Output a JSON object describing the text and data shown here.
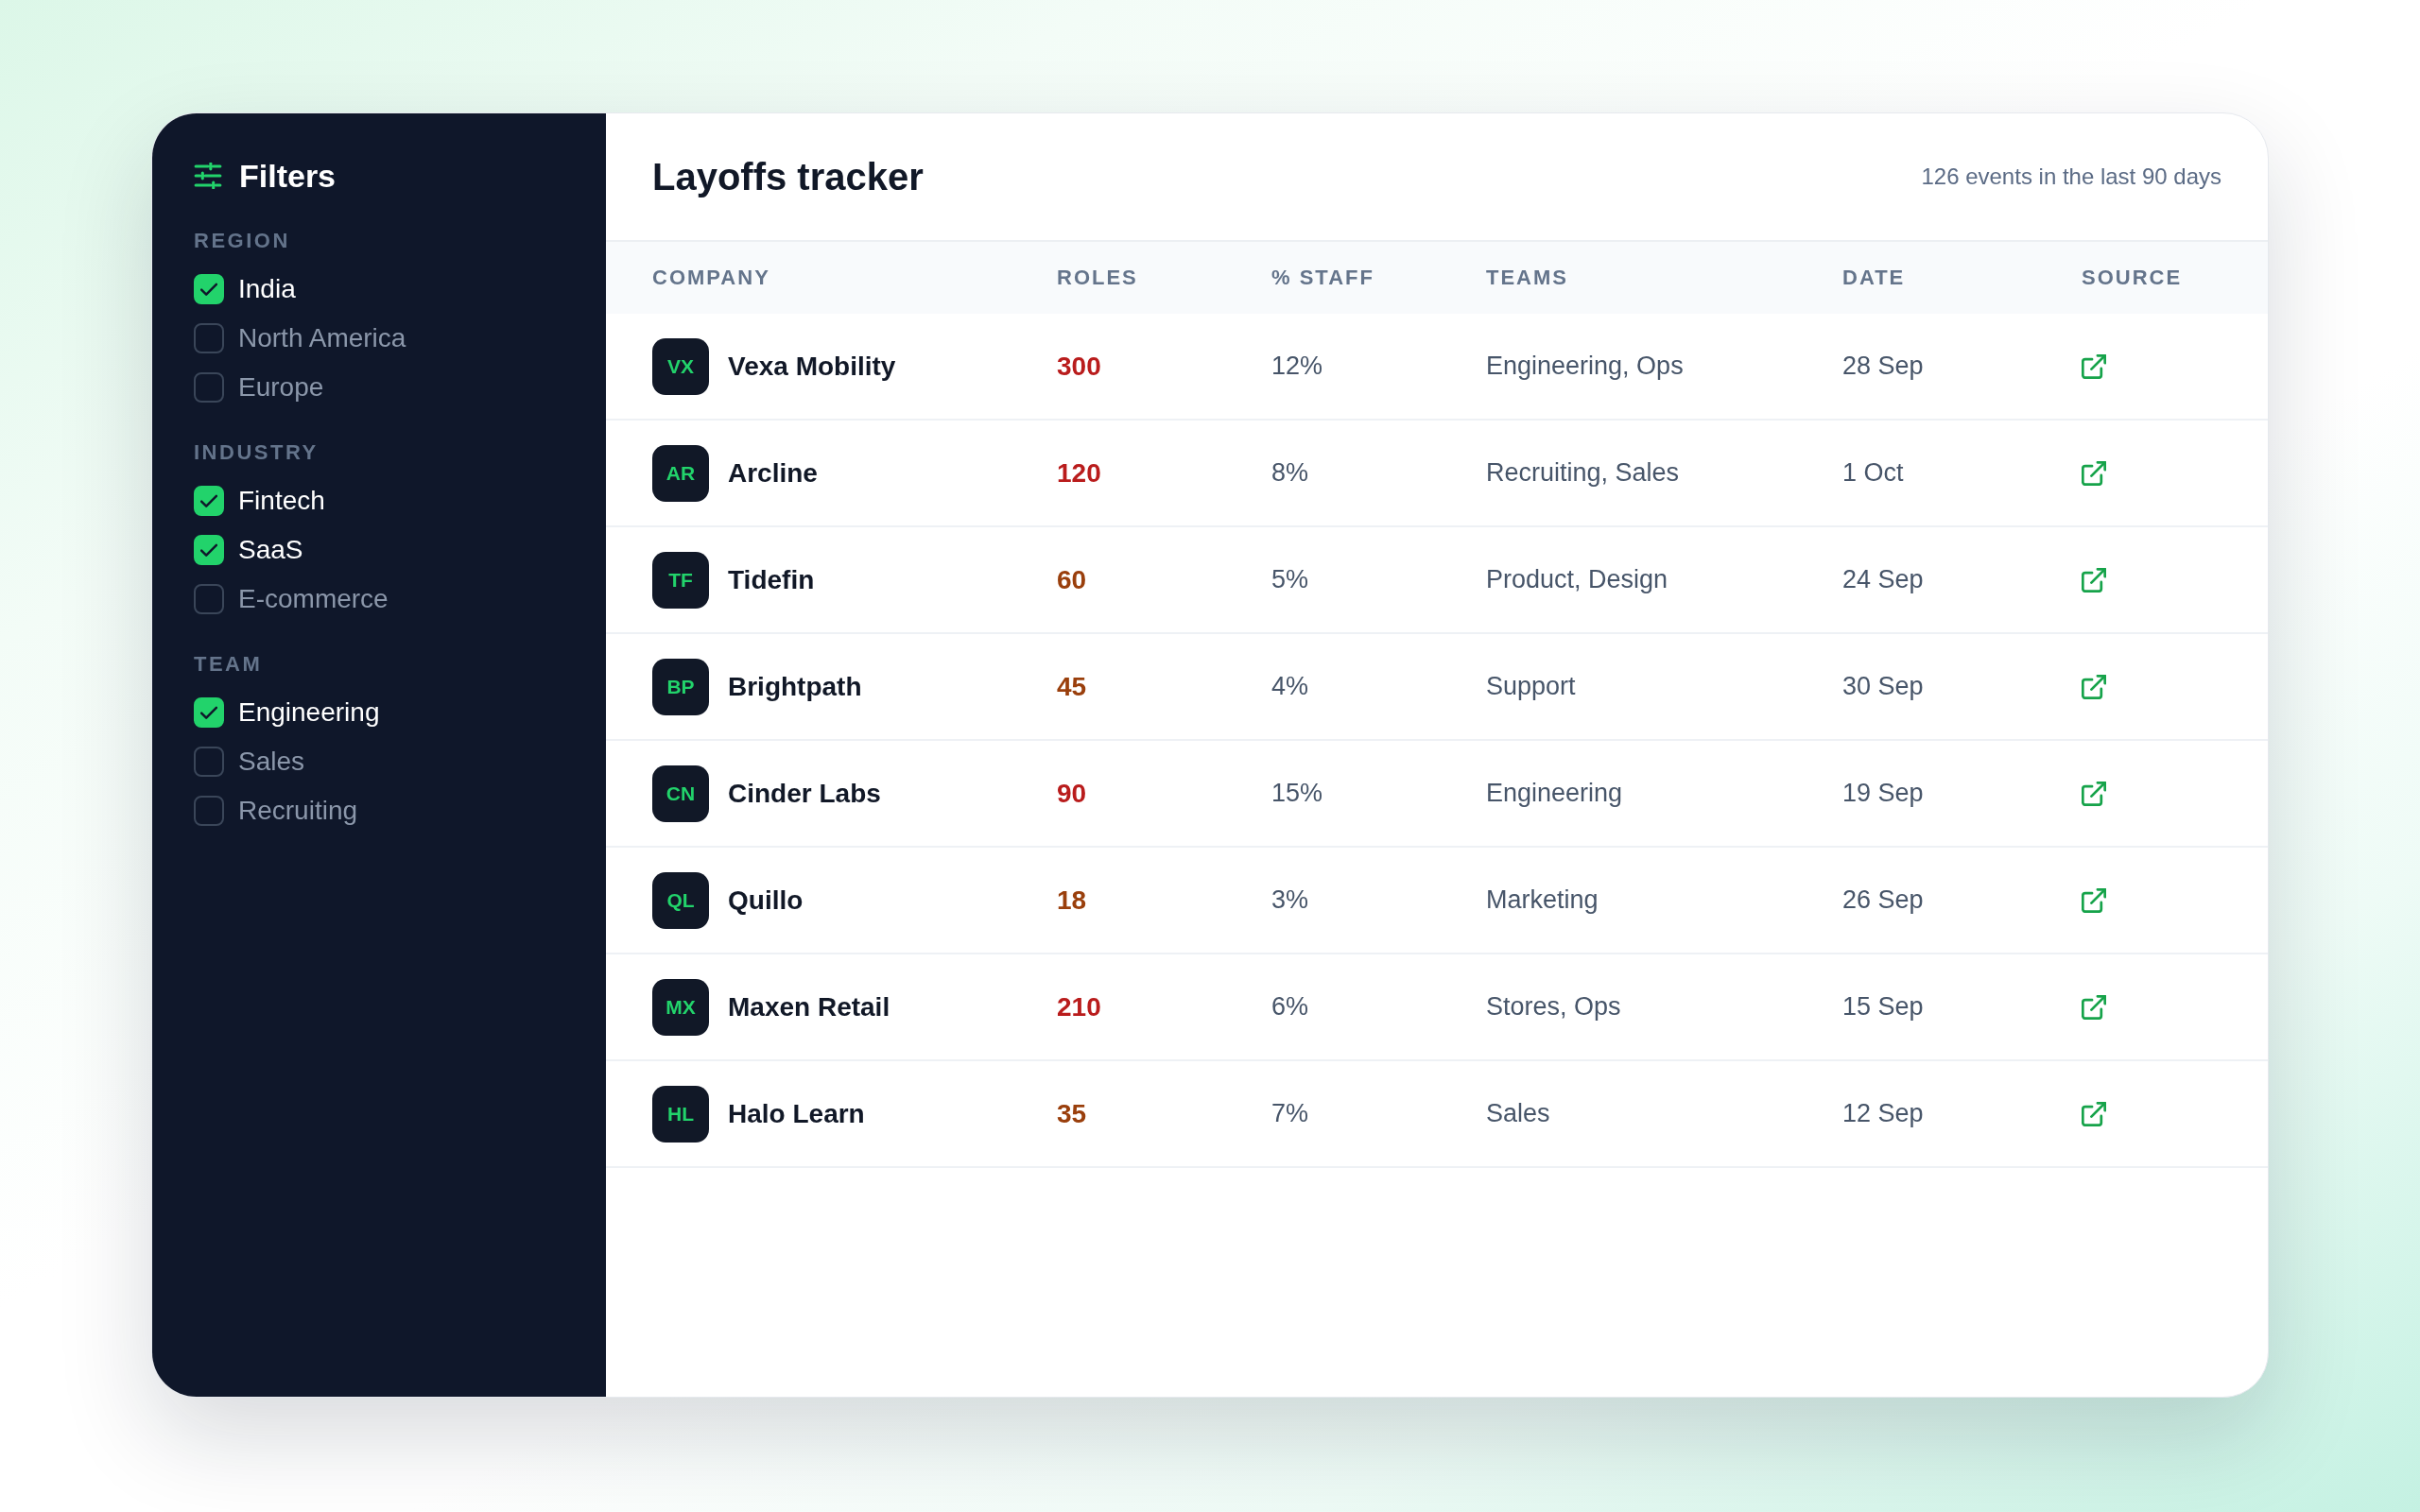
{
  "sidebar": {
    "title": "Filters",
    "groups": [
      {
        "label": "REGION",
        "options": [
          {
            "label": "India",
            "checked": true
          },
          {
            "label": "North America",
            "checked": false
          },
          {
            "label": "Europe",
            "checked": false
          }
        ]
      },
      {
        "label": "INDUSTRY",
        "options": [
          {
            "label": "Fintech",
            "checked": true
          },
          {
            "label": "SaaS",
            "checked": true
          },
          {
            "label": "E-commerce",
            "checked": false
          }
        ]
      },
      {
        "label": "TEAM",
        "options": [
          {
            "label": "Engineering",
            "checked": true
          },
          {
            "label": "Sales",
            "checked": false
          },
          {
            "label": "Recruiting",
            "checked": false
          }
        ]
      }
    ]
  },
  "header": {
    "title": "Layoffs tracker",
    "summary": "126 events in the last 90 days"
  },
  "table": {
    "columns": [
      "COMPANY",
      "ROLES",
      "% STAFF",
      "TEAMS",
      "DATE",
      "SOURCE"
    ],
    "rows": [
      {
        "initials": "VX",
        "company": "Vexa Mobility",
        "roles": "300",
        "color": "#b91c1c",
        "staff": "12%",
        "teams": "Engineering, Ops",
        "date": "28 Sep"
      },
      {
        "initials": "AR",
        "company": "Arcline",
        "roles": "120",
        "color": "#b91c1c",
        "staff": "8%",
        "teams": "Recruiting, Sales",
        "date": "1 Oct"
      },
      {
        "initials": "TF",
        "company": "Tidefin",
        "roles": "60",
        "color": "#9a3f0c",
        "staff": "5%",
        "teams": "Product, Design",
        "date": "24 Sep"
      },
      {
        "initials": "BP",
        "company": "Brightpath",
        "roles": "45",
        "color": "#9a3f0c",
        "staff": "4%",
        "teams": "Support",
        "date": "30 Sep"
      },
      {
        "initials": "CN",
        "company": "Cinder Labs",
        "roles": "90",
        "color": "#b91c1c",
        "staff": "15%",
        "teams": "Engineering",
        "date": "19 Sep"
      },
      {
        "initials": "QL",
        "company": "Quillo",
        "roles": "18",
        "color": "#9a3f0c",
        "staff": "3%",
        "teams": "Marketing",
        "date": "26 Sep"
      },
      {
        "initials": "MX",
        "company": "Maxen Retail",
        "roles": "210",
        "color": "#b91c1c",
        "staff": "6%",
        "teams": "Stores, Ops",
        "date": "15 Sep"
      },
      {
        "initials": "HL",
        "company": "Halo Learn",
        "roles": "35",
        "color": "#9a3f0c",
        "staff": "7%",
        "teams": "Sales",
        "date": "12 Sep"
      }
    ]
  }
}
